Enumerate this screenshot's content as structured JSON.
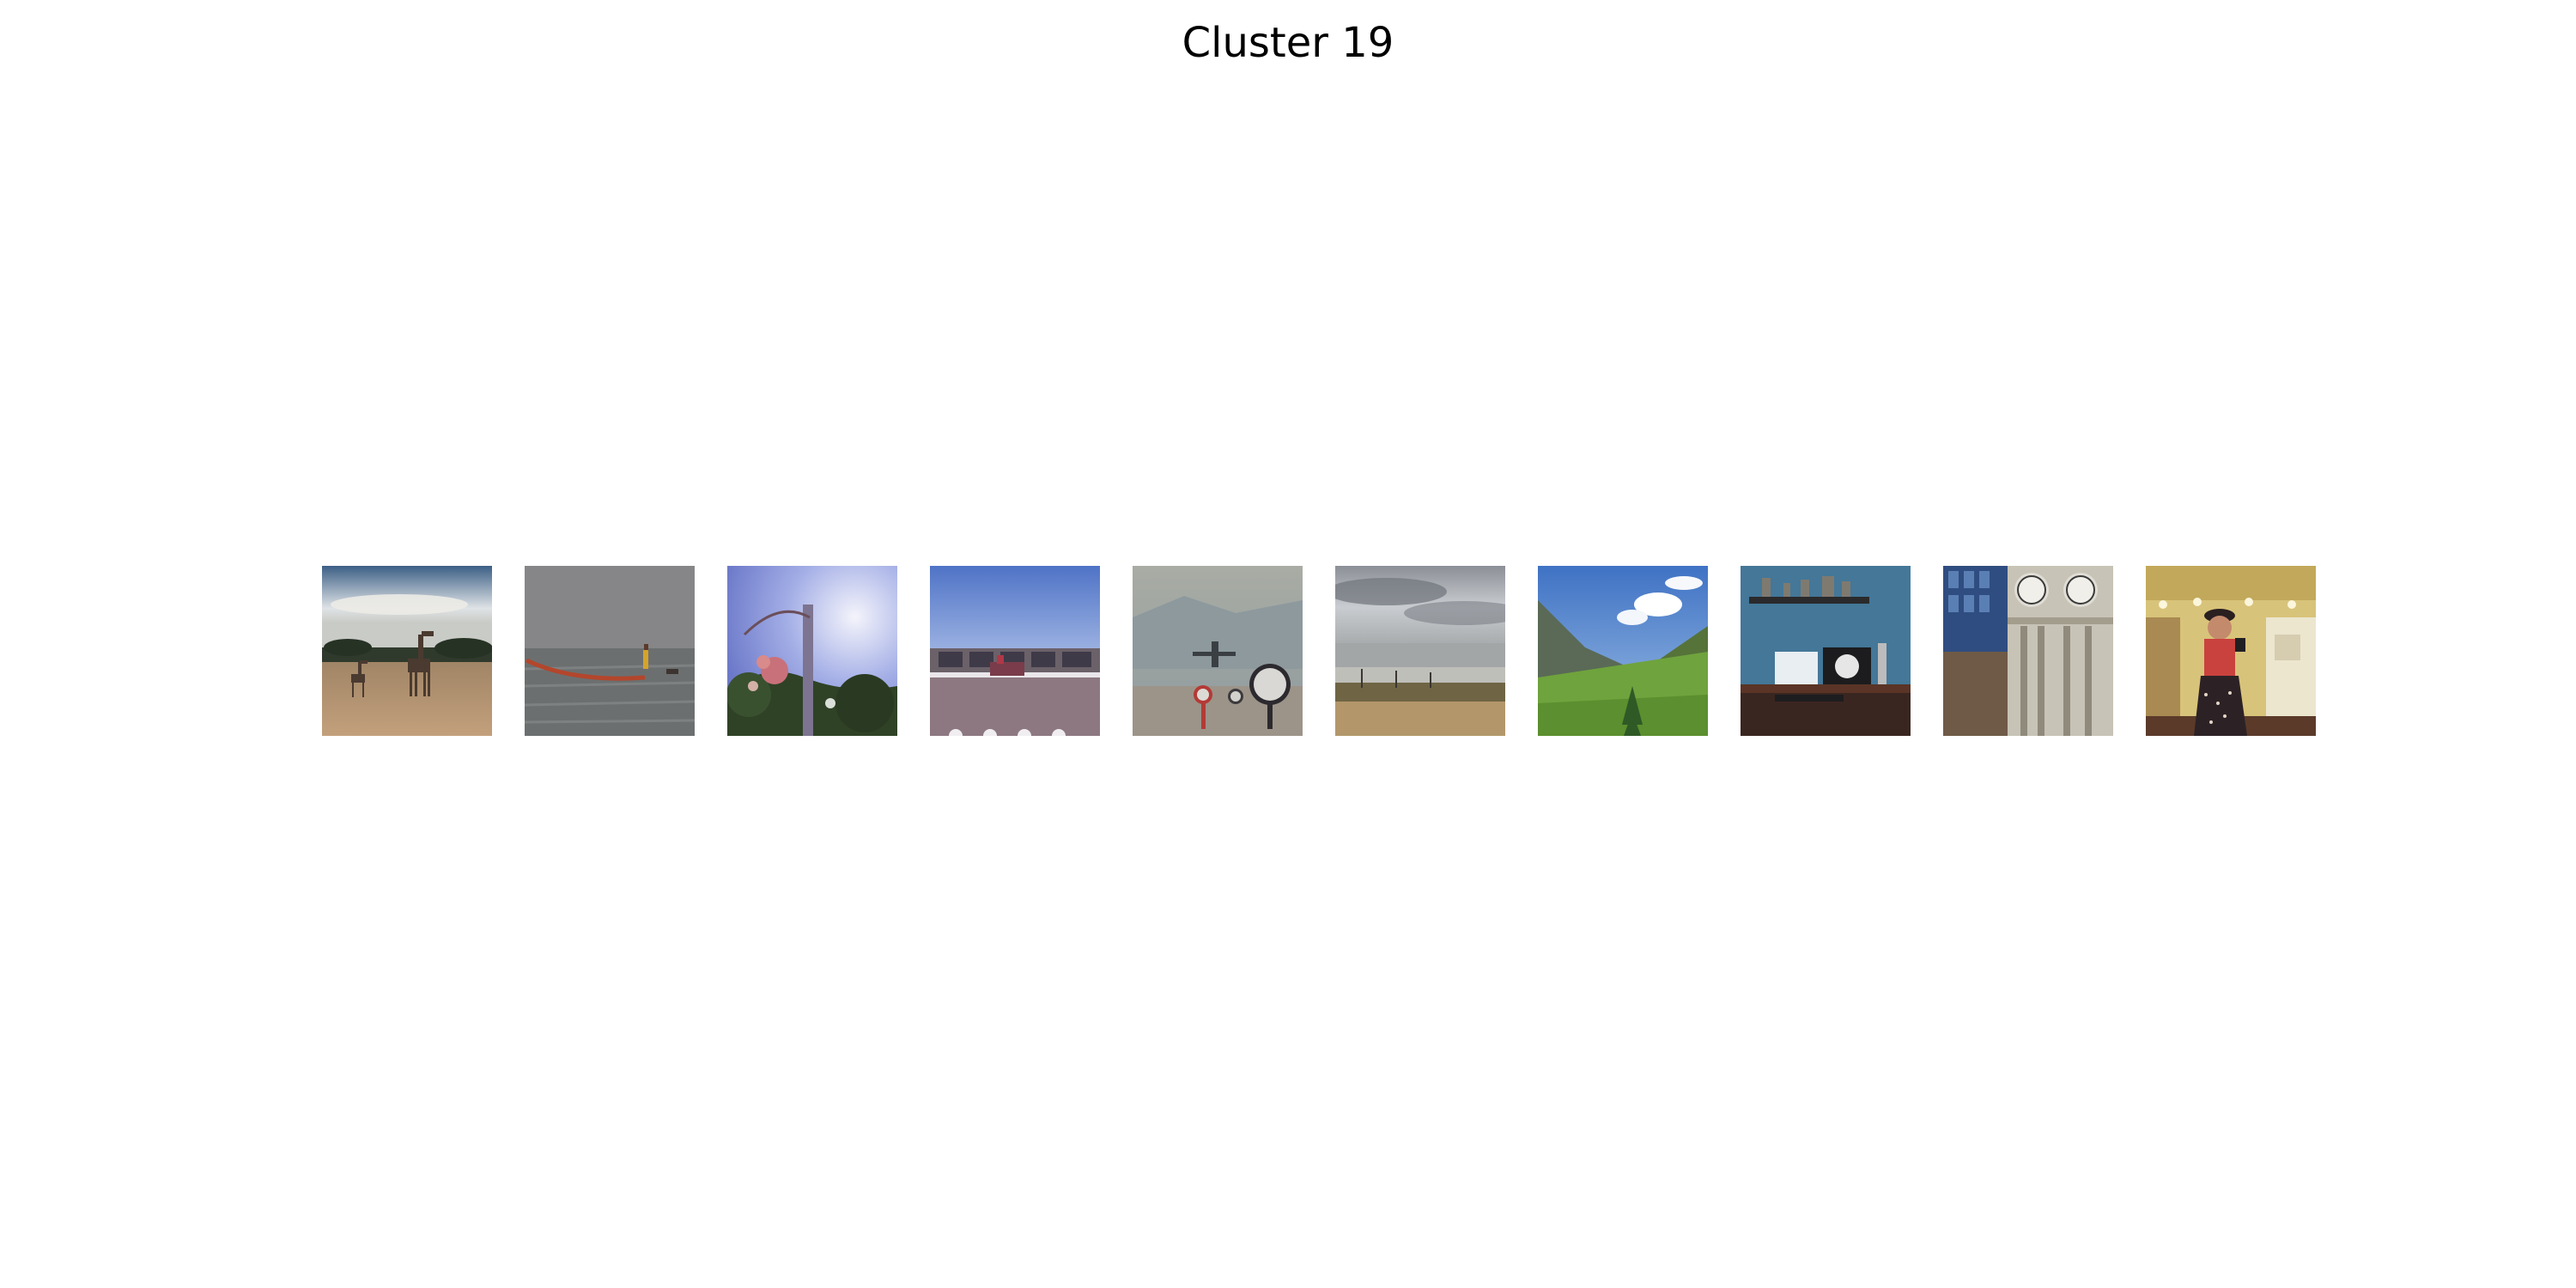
{
  "title": "Cluster 19",
  "thumbnails": [
    {
      "depicts": "giraffe-savanna-photo"
    },
    {
      "depicts": "beach-fisherman-net-photo"
    },
    {
      "depicts": "flowering-vine-pole-photo"
    },
    {
      "depicts": "horse-race-track-photo"
    },
    {
      "depicts": "airplane-landing-clocks-photo"
    },
    {
      "depicts": "stormy-beach-photo"
    },
    {
      "depicts": "mountain-valley-photo"
    },
    {
      "depicts": "desk-computer-shelf-photo"
    },
    {
      "depicts": "clock-tower-building-photo"
    },
    {
      "depicts": "woman-mirror-selfie-photo"
    }
  ]
}
